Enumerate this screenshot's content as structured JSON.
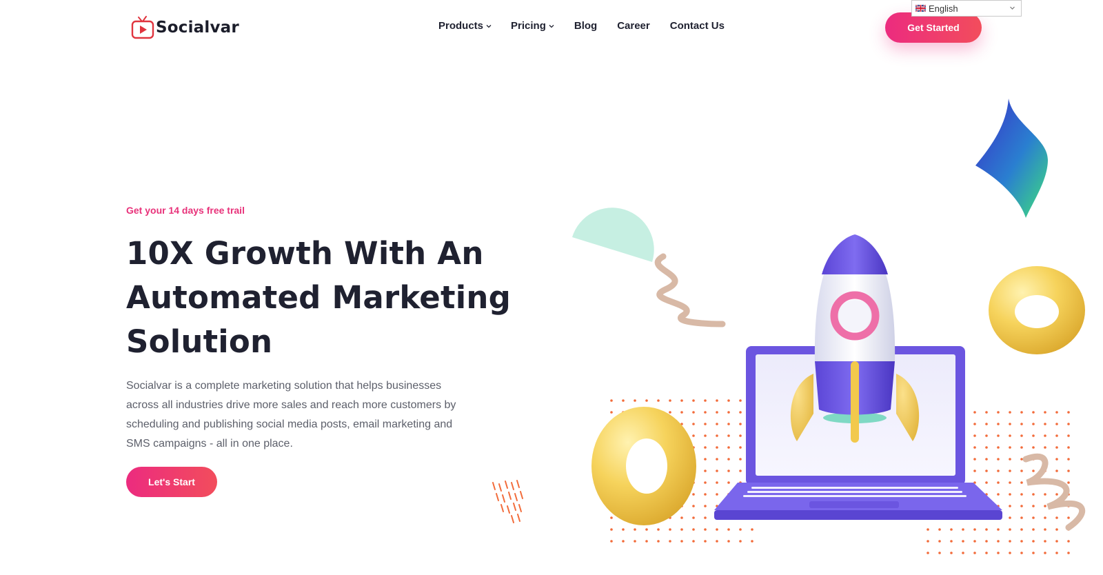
{
  "brand": {
    "name": "Socialvar"
  },
  "nav": {
    "products": "Products",
    "pricing": "Pricing",
    "blog": "Blog",
    "career": "Career",
    "contact": "Contact Us"
  },
  "language": {
    "selected": "English"
  },
  "header": {
    "cta": "Get Started"
  },
  "hero": {
    "eyebrow": "Get your 14 days free trail",
    "title": "10X Growth With An Automated Marketing Solution",
    "description": "Socialvar is a complete marketing solution that helps businesses across all industries drive more sales and reach more customers by scheduling and publishing social media posts, email marketing and SMS campaigns - all in one place.",
    "cta": "Let's Start"
  },
  "colors": {
    "accent_pink": "#ec2b7f",
    "accent_coral": "#f24d5c",
    "text_dark": "#1f2130",
    "text_muted": "#5c5f6a",
    "laptop_purple": "#6b55e0",
    "donut_yellow": "#f2c94c",
    "dot_orange": "#f26b3a"
  },
  "icons": {
    "logo": "tv-play-icon",
    "dropdown": "chevron-down-icon",
    "flag": "uk-flag-icon"
  }
}
